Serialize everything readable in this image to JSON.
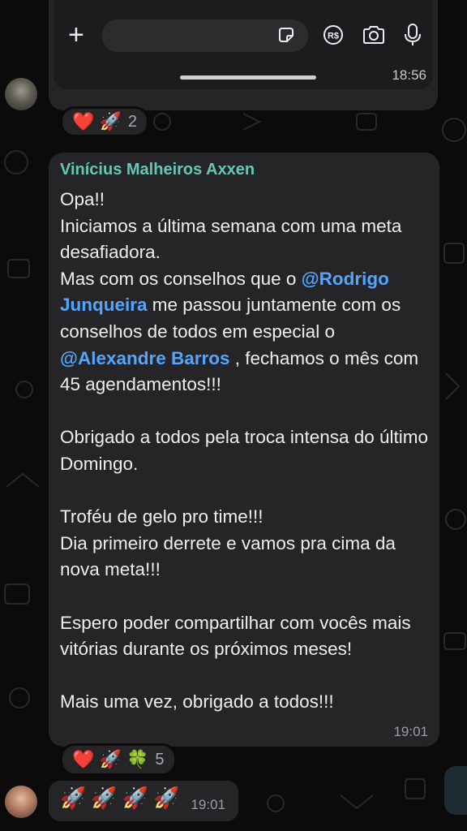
{
  "input_bar": {
    "placeholder": "",
    "icons": [
      "plus-icon",
      "sticker-icon",
      "payment-icon",
      "camera-icon",
      "mic-icon"
    ],
    "payment_label": "R$"
  },
  "previous_message": {
    "time": "18:56"
  },
  "previous_reactions": {
    "emojis": "❤️ 🚀",
    "count": "2"
  },
  "message": {
    "sender": "Vinícius Malheiros Axxen",
    "segments": [
      {
        "text": "Opa!!\nIniciamos a última semana com uma meta desafiadora.\nMas com os conselhos que o ",
        "mention": false
      },
      {
        "text": "@Rodrigo Junqueira",
        "mention": true
      },
      {
        "text": " me passou juntamente com os conselhos de todos em especial o ",
        "mention": false
      },
      {
        "text": "@Alexandre Barros",
        "mention": true
      },
      {
        "text": " , fechamos o mês com 45 agendamentos!!!\n\nObrigado a todos pela troca intensa do último Domingo.\n\nTroféu de gelo pro time!!!\nDia primeiro derrete e vamos pra cima da nova meta!!!\n\nEspero poder compartilhar com vocês mais vitórias durante os próximos meses!\n\nMais uma vez, obrigado a todos!!!",
        "mention": false
      }
    ],
    "time": "19:01"
  },
  "message_reactions": {
    "emojis": "❤️ 🚀 🍀",
    "count": "5"
  },
  "rocket_message": {
    "text": "🚀🚀🚀🚀",
    "time": "19:01"
  },
  "colors": {
    "background": "#0b0b0b",
    "bubble": "#252527",
    "sender_name": "#63c8b4",
    "mention": "#53a6ff"
  }
}
